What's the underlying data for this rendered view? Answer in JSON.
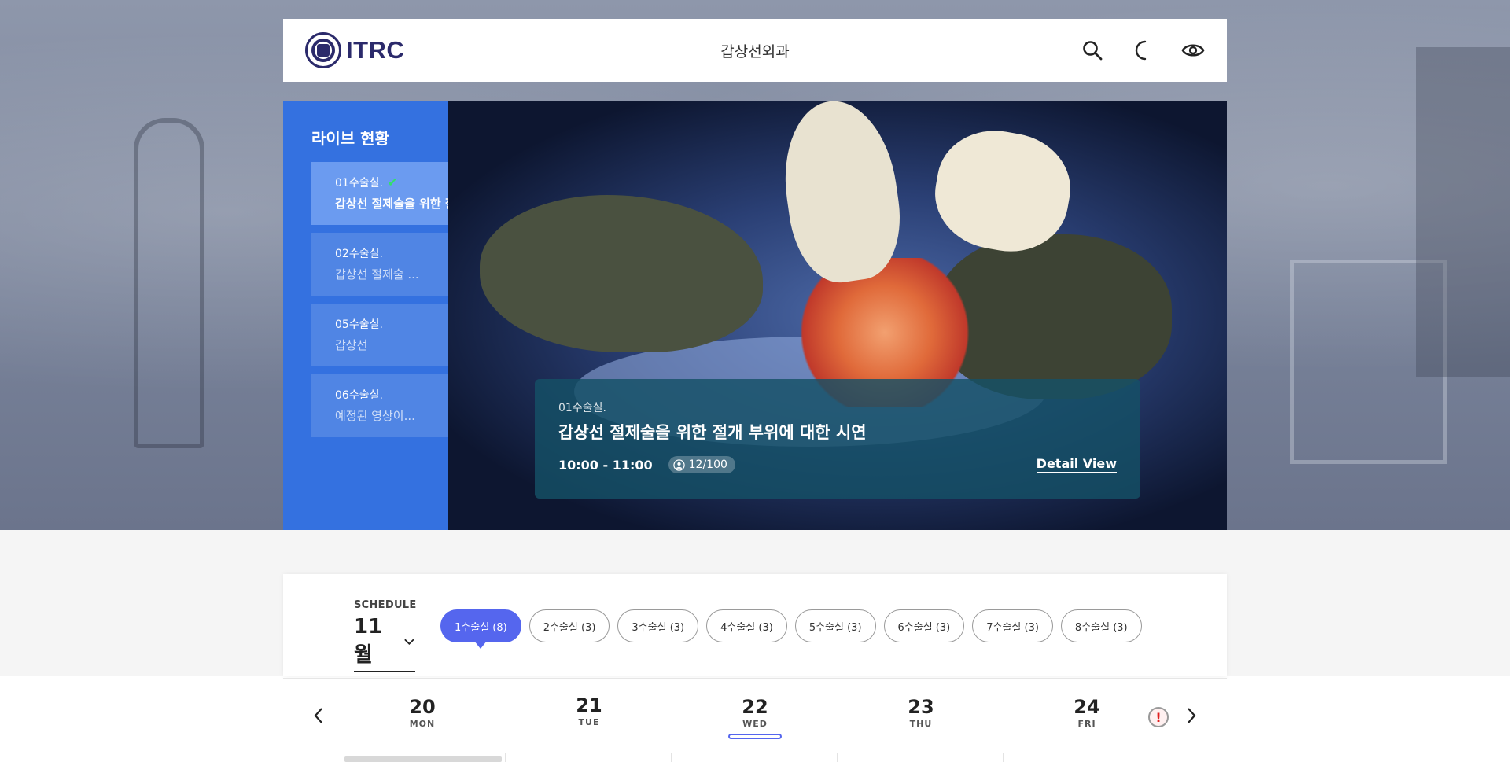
{
  "header": {
    "logo_text": "ITRC",
    "department": "갑상선외과",
    "icons": [
      "search-icon",
      "moon-icon",
      "eye-icon"
    ]
  },
  "live": {
    "heading": "라이브 현황",
    "items": [
      {
        "room": "01수술실.",
        "title": "갑상선 절제술을 위한 절개...",
        "active": true,
        "status_icon": "check-icon"
      },
      {
        "room": "02수술실.",
        "title": "갑상선 절제술 ...",
        "active": false
      },
      {
        "room": "05수술실.",
        "title": "갑상선",
        "active": false
      },
      {
        "room": "06수술실.",
        "title": "예정된 영상이...",
        "active": false
      }
    ]
  },
  "video": {
    "room": "01수술실.",
    "title": "갑상선 절제술을 위한 절개 부위에 대한 시연",
    "time": "10:00 - 11:00",
    "viewers": "12/100",
    "detail_label": "Detail View"
  },
  "schedule": {
    "label": "SCHEDULE",
    "month": "11월",
    "rooms": [
      {
        "label": "1수술실 (8)",
        "active": true
      },
      {
        "label": "2수술실 (3)",
        "active": false
      },
      {
        "label": "3수술실 (3)",
        "active": false
      },
      {
        "label": "4수술실 (3)",
        "active": false
      },
      {
        "label": "5수술실 (3)",
        "active": false
      },
      {
        "label": "6수술실 (3)",
        "active": false
      },
      {
        "label": "7수술실 (3)",
        "active": false
      },
      {
        "label": "8수술실 (3)",
        "active": false
      }
    ],
    "days": [
      {
        "num": "20",
        "dow": "MON",
        "active": false
      },
      {
        "num": "21",
        "dow": "TUE",
        "active": false
      },
      {
        "num": "22",
        "dow": "WED",
        "active": true
      },
      {
        "num": "23",
        "dow": "THU",
        "active": false
      },
      {
        "num": "24",
        "dow": "FRI",
        "active": false
      }
    ],
    "alert_symbol": "!"
  },
  "colors": {
    "accent": "#5566ee",
    "live_panel": "#3471e0",
    "check": "#33e06a",
    "brand": "#2b2a6b"
  }
}
